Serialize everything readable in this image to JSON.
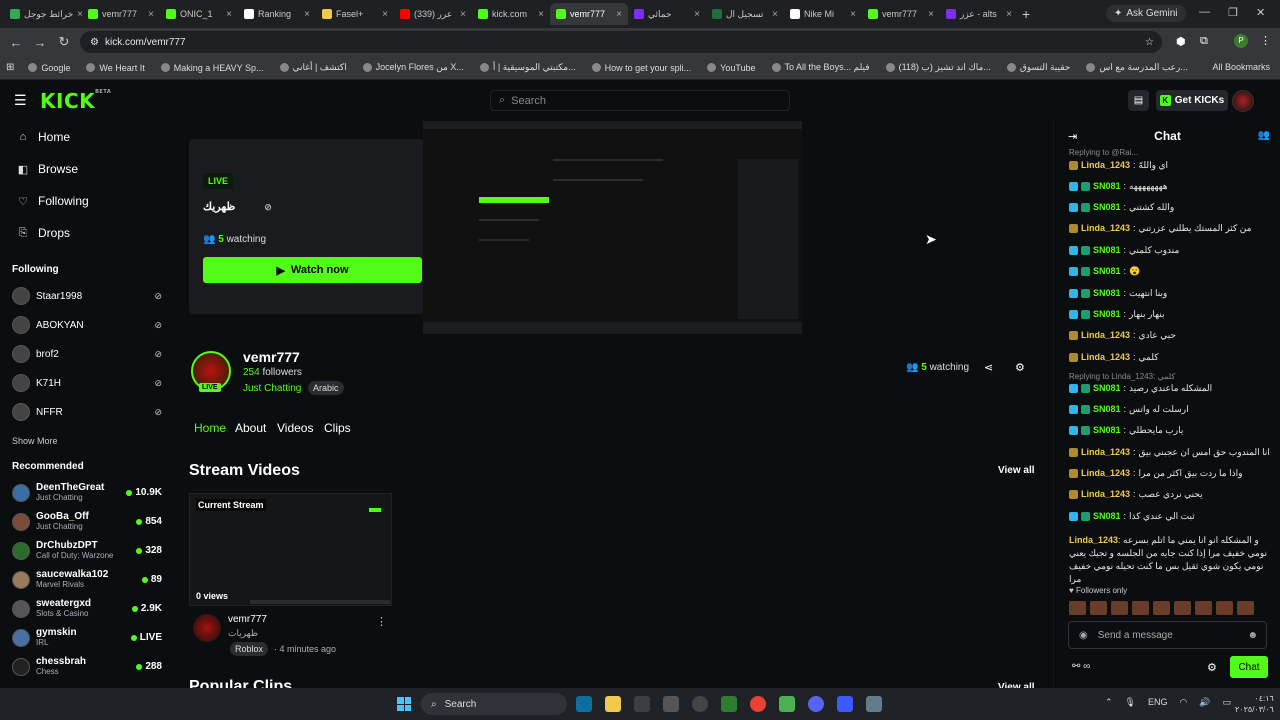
{
  "browser": {
    "tabs": [
      {
        "label": "خرائط جوجل",
        "color": "#34a853"
      },
      {
        "label": "vemr777",
        "color": "#53fc18"
      },
      {
        "label": "ONIC_1",
        "color": "#53fc18"
      },
      {
        "label": "Ranking",
        "color": "#ffffff"
      },
      {
        "label": "Fasel+",
        "color": "#f2c94c"
      },
      {
        "label": "(339) عرر",
        "color": "#ff0000"
      },
      {
        "label": "kick.com",
        "color": "#53fc18"
      },
      {
        "label": "vemr777",
        "color": "#53fc18",
        "active": true
      },
      {
        "label": "حمائي",
        "color": "#7b2ff7"
      },
      {
        "label": "تسجيل ال",
        "color": "#1e6e3e"
      },
      {
        "label": "Nike Mi",
        "color": "#ffffff"
      },
      {
        "label": "vemr777",
        "color": "#53fc18"
      },
      {
        "label": "عزر - alts",
        "color": "#7b2ff7"
      }
    ],
    "gemini_label": "Ask Gemini",
    "url": "kick.com/vemr777",
    "bookmarks": [
      "Google",
      "We Heart It",
      "Making a HEAVY Sp...",
      "اكتشف | أغاني",
      "Jocelyn Flores من X...",
      "مكتبتي الموسيقية | أ...",
      "How to get your spli...",
      "YouTube",
      "To All the Boys... فيلم",
      "(118) ماك اند تشيز (ب...",
      "حقيبة التسوق",
      "رعب المدرسة مع اس..."
    ],
    "all_bookmarks": "All Bookmarks"
  },
  "header": {
    "logo": "KICK",
    "logo_sup": "BETA",
    "search_placeholder": "Search",
    "get_kicks": "Get KICKs"
  },
  "sidebar": {
    "nav": [
      {
        "label": "Home",
        "icon": "home-icon"
      },
      {
        "label": "Browse",
        "icon": "browse-icon"
      },
      {
        "label": "Following",
        "icon": "heart-icon"
      },
      {
        "label": "Drops",
        "icon": "drops-icon"
      }
    ],
    "following_heading": "Following",
    "following": [
      "Staar1998",
      "ABOKYAN",
      "brof2",
      "K71H",
      "NFFR"
    ],
    "show_more": "Show More",
    "recommended_heading": "Recommended",
    "recommended": [
      {
        "name": "DeenTheGreat",
        "category": "Just Chatting",
        "count": "10.9K"
      },
      {
        "name": "GooBa_Off",
        "category": "Just Chatting",
        "count": "854"
      },
      {
        "name": "DrChubzDPT",
        "category": "Call of Duty: Warzone",
        "count": "328"
      },
      {
        "name": "saucewalka102",
        "category": "Marvel Rivals",
        "count": "89"
      },
      {
        "name": "sweatergxd",
        "category": "Slots & Casino",
        "count": "2.9K"
      },
      {
        "name": "gymskin",
        "category": "IRL",
        "count": "LIVE"
      },
      {
        "name": "chessbrah",
        "category": "Chess",
        "count": "288"
      }
    ]
  },
  "main": {
    "live_badge": "LIVE",
    "stream_title": "ظهريك",
    "watching_count": "5",
    "watching_label": "watching",
    "watch_now": "Watch now",
    "channel_name": "vemr777",
    "followers_count": "254",
    "followers_label": "followers",
    "category": "Just Chatting",
    "tag": "Arabic",
    "avatar_live": "LIVE",
    "tabs": [
      "Home",
      "About",
      "Videos",
      "Clips"
    ],
    "stream_videos_heading": "Stream Videos",
    "view_all": "View all",
    "video": {
      "label": "Current Stream",
      "views": "0 views",
      "channel": "vemr777",
      "title": "ظهريات",
      "tag": "Roblox",
      "ago": "4 minutes ago"
    },
    "popular_clips_heading": "Popular Clips"
  },
  "chat": {
    "title": "Chat",
    "messages": [
      {
        "user": "Linda_1243",
        "text": "اي واللهّ",
        "color": "#f2c94c",
        "sub": true
      },
      {
        "user": "SN081",
        "text": "ههههههههه",
        "color": "#53fc18",
        "sub": false
      },
      {
        "user": "SN081",
        "text": "والله كشتني",
        "color": "#53fc18",
        "sub": false
      },
      {
        "user": "Linda_1243",
        "text": "من كثر المستك يطلني عزرتني",
        "color": "#f2c94c",
        "sub": true
      },
      {
        "user": "SN081",
        "text": "مندوب كلمني",
        "color": "#53fc18",
        "sub": false
      },
      {
        "user": "SN081",
        "text": "😮",
        "color": "#53fc18",
        "sub": false
      },
      {
        "user": "SN081",
        "text": "وبنا انتهيت",
        "color": "#53fc18",
        "sub": false
      },
      {
        "user": "SN081",
        "text": "بنهار بنهار",
        "color": "#53fc18",
        "sub": false
      },
      {
        "user": "Linda_1243",
        "text": "حبي عادي",
        "color": "#f2c94c",
        "sub": true
      },
      {
        "user": "Linda_1243",
        "text": "كلمي",
        "color": "#f2c94c",
        "sub": true
      },
      {
        "user": "SN081",
        "text": "المشكله ماعندي رصيد",
        "color": "#53fc18",
        "sub": false
      },
      {
        "user": "SN081",
        "text": "ارسلت له واتس",
        "color": "#53fc18",
        "sub": false
      },
      {
        "user": "SN081",
        "text": "يارب مايحطلي",
        "color": "#53fc18",
        "sub": false
      },
      {
        "user": "Linda_1243",
        "text": "انا المندوب حق امس ان عجبني بيق",
        "color": "#f2c94c",
        "sub": true
      },
      {
        "user": "Linda_1243",
        "text": "واذا ما ردت بيق اكثر من مرا",
        "color": "#f2c94c",
        "sub": true
      },
      {
        "user": "Linda_1243",
        "text": "يحني نردي عصب",
        "color": "#f2c94c",
        "sub": true
      },
      {
        "user": "SN081",
        "text": "ثبت الي عندي كذا",
        "color": "#53fc18",
        "sub": false
      }
    ],
    "reply_1": "Replying to @Rai...",
    "reply_2": "Replying to Linda_1243: كلمي",
    "last_user": "Linda_1243",
    "last_text": "و المشكله انو انا يمني ما اتلم بسرعه نومي خفيف مرا إذا كنت جايه من الجلسه و تجيك يعني نومي يكون شوي ثقيل بس ما كنت تحيله نومي خفيف مرا",
    "followers_only": "Followers only",
    "input_placeholder": "Send a message",
    "send_label": "Chat"
  },
  "taskbar": {
    "search_label": "Search",
    "lang": "ENG",
    "time": "٠٤:١٦",
    "date": "٢٠٢٥/٠٣/٠٦"
  }
}
